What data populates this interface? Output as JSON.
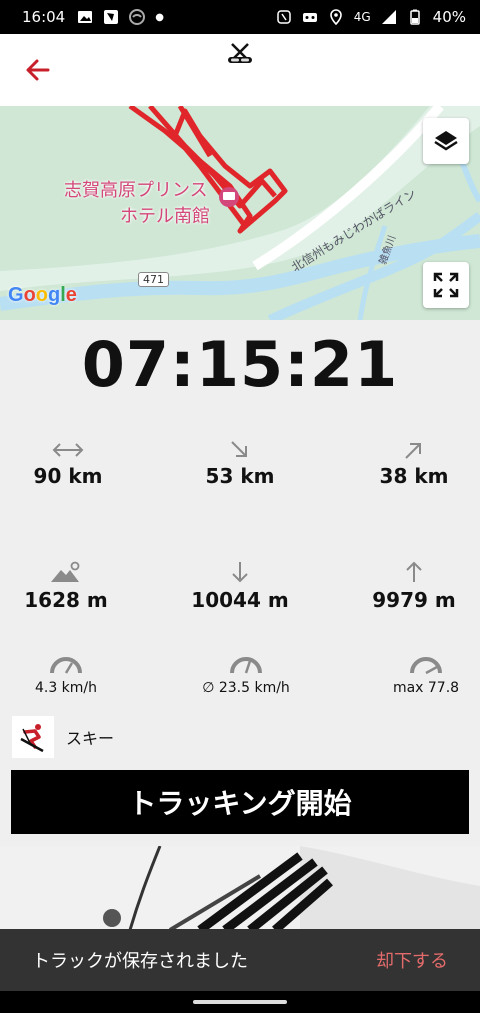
{
  "status_bar": {
    "time": "16:04",
    "network": "4G",
    "battery": "40%"
  },
  "map": {
    "hotel_line1": "志賀高原プリンス",
    "hotel_line2": "ホテル南館",
    "road_label": "北信州もみじわかばライン",
    "river_label": "雑魚川",
    "route_number": "471",
    "google_logo": "Google",
    "track_color": "#e0262b"
  },
  "timer": "07:15:21",
  "stats": {
    "distance": "90 km",
    "downhill_distance": "53 km",
    "uphill_distance": "38 km",
    "max_altitude": "1628 m",
    "descent": "10044 m",
    "ascent": "9979 m",
    "speed_current": "4.3 km/h",
    "speed_avg": "∅ 23.5 km/h",
    "speed_max": "max 77.8"
  },
  "activity": {
    "label": "スキー"
  },
  "start_button": "トラッキング開始",
  "snackbar": {
    "message": "トラックが保存されました",
    "action": "却下する"
  },
  "colors": {
    "accent_red": "#c8202a",
    "snack_action": "#e46b6b"
  }
}
